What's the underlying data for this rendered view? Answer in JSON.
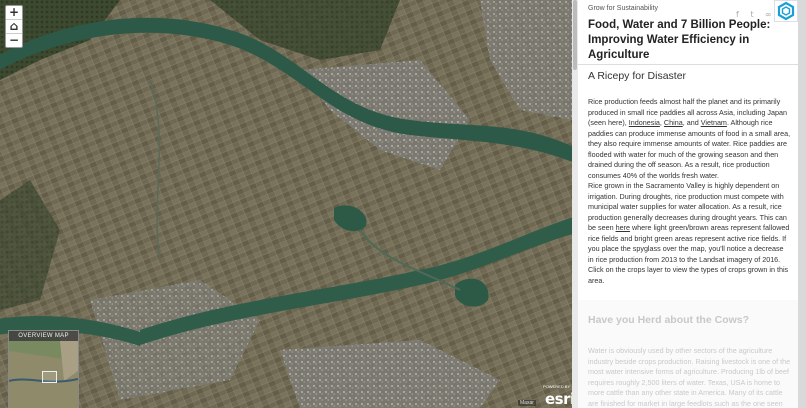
{
  "map": {
    "zoom_in": "+",
    "home": "⌂",
    "zoom_out": "−",
    "overview_label": "OVERVIEW MAP",
    "powered_by": "POWERED BY",
    "esri_logo": "esri",
    "attribution": "Maxar"
  },
  "panel": {
    "brand": "Grow for Sustainability",
    "social": {
      "facebook": "f",
      "twitter": "t",
      "link": "∞"
    },
    "title": "Food, Water and 7 Billion People: Improving Water Efficiency in Agriculture",
    "section1": {
      "heading": "A Ricepy for Disaster",
      "p1_a": "Rice production feeds almost half the planet and its primarily produced in small rice paddies all across Asia, including Japan (seen here), ",
      "link_indonesia": "Indonesia",
      "sep1": ", ",
      "link_china": "China",
      "sep2": ", and ",
      "link_vietnam": "Vietnam",
      "p1_b": ". Although rice paddies can produce immense amounts of food in a small area, they also require immense amounts of water. Rice paddies are flooded with water for much of the growing season and then drained during the off season. As a result, rice production consumes 40% of the worlds fresh water.",
      "p2_a": "Rice grown in the Sacramento Valley is highly dependent on irrigation. During droughts, rice production must compete with municipal water supplies for water allocation. As a result, rice production generally decreases during drought years. This can be seen ",
      "link_here": "here",
      "p2_b": " where light green/brown areas represent fallowed rice fields and bright green areas represent active rice fields. If you place the spyglass over the map, you'll notice a decrease in rice production from 2013 to the Landsat imagery of 2016. Click on the crops layer to view the types of crops grown in this area."
    },
    "section2": {
      "heading": "Have you Herd about the Cows?",
      "p1": "Water is obviously used by other sectors of the agriculture industry beside crops production. Raising livestock is one of the most water intensive forms of agriculture. Producing 1lb of beef requires roughly 2,500 liters of water. Texas, USA is home to more cattle than any other state in America. Many of its cattle are finished for market in large feedlots such as the one seen here. These feedlots require massive amounts of water"
    }
  },
  "colors": {
    "river": "#2d5a48",
    "fields": "#6b6450",
    "panel_bg": "#ffffff",
    "logo_accent": "#1a9fd4"
  }
}
